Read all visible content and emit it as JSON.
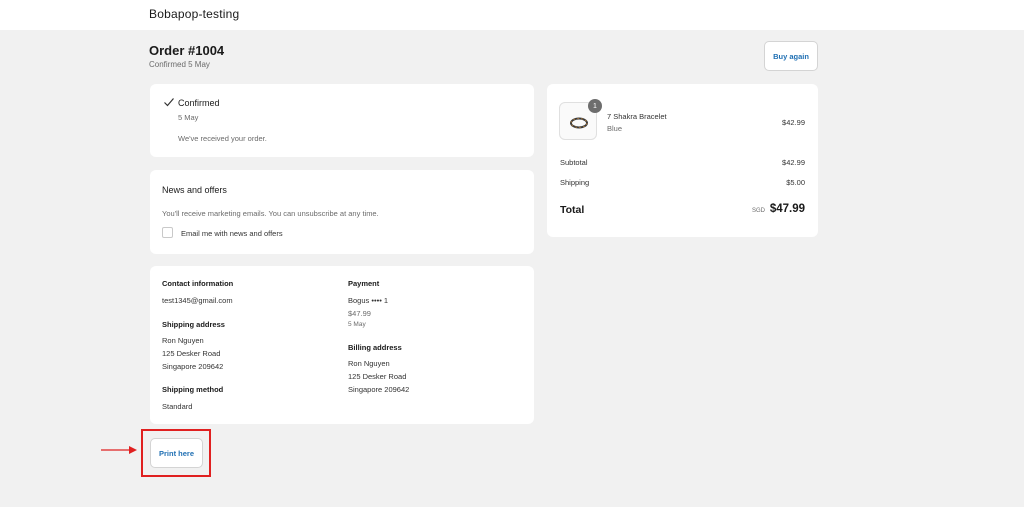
{
  "header": {
    "shop_name": "Bobapop-testing"
  },
  "order": {
    "title": "Order #1004",
    "confirmed_date": "Confirmed 5 May",
    "buy_again_label": "Buy again"
  },
  "status": {
    "title": "Confirmed",
    "date": "5 May",
    "message": "We've received your order."
  },
  "news": {
    "title": "News and offers",
    "description": "You'll receive marketing emails. You can unsubscribe at any time.",
    "checkbox_label": "Email me with news and offers"
  },
  "details": {
    "contact_heading": "Contact information",
    "contact_email": "test1345@gmail.com",
    "shipping_heading": "Shipping address",
    "shipping_name": "Ron Nguyen",
    "shipping_street": "125 Desker Road",
    "shipping_city": "Singapore 209642",
    "method_heading": "Shipping method",
    "method_value": "Standard",
    "payment_heading": "Payment",
    "payment_method": "Bogus •••• 1",
    "payment_amount": "$47.99",
    "payment_date": "5 May",
    "billing_heading": "Billing address",
    "billing_name": "Ron Nguyen",
    "billing_street": "125 Desker Road",
    "billing_city": "Singapore 209642"
  },
  "summary": {
    "item_name": "7 Shakra Bracelet",
    "item_variant": "Blue",
    "item_price": "$42.99",
    "item_quantity": "1",
    "subtotal_label": "Subtotal",
    "subtotal_value": "$42.99",
    "shipping_label": "Shipping",
    "shipping_value": "$5.00",
    "total_label": "Total",
    "currency": "SGD",
    "total_value": "$47.99"
  },
  "print_label": "Print here",
  "icons": {
    "check": "checkmark-icon",
    "arrow": "red-arrow-icon",
    "thumbnail": "bracelet-image"
  },
  "colors": {
    "link": "#1f6fb3",
    "highlight": "#e02020",
    "background": "#f1f1f1"
  }
}
